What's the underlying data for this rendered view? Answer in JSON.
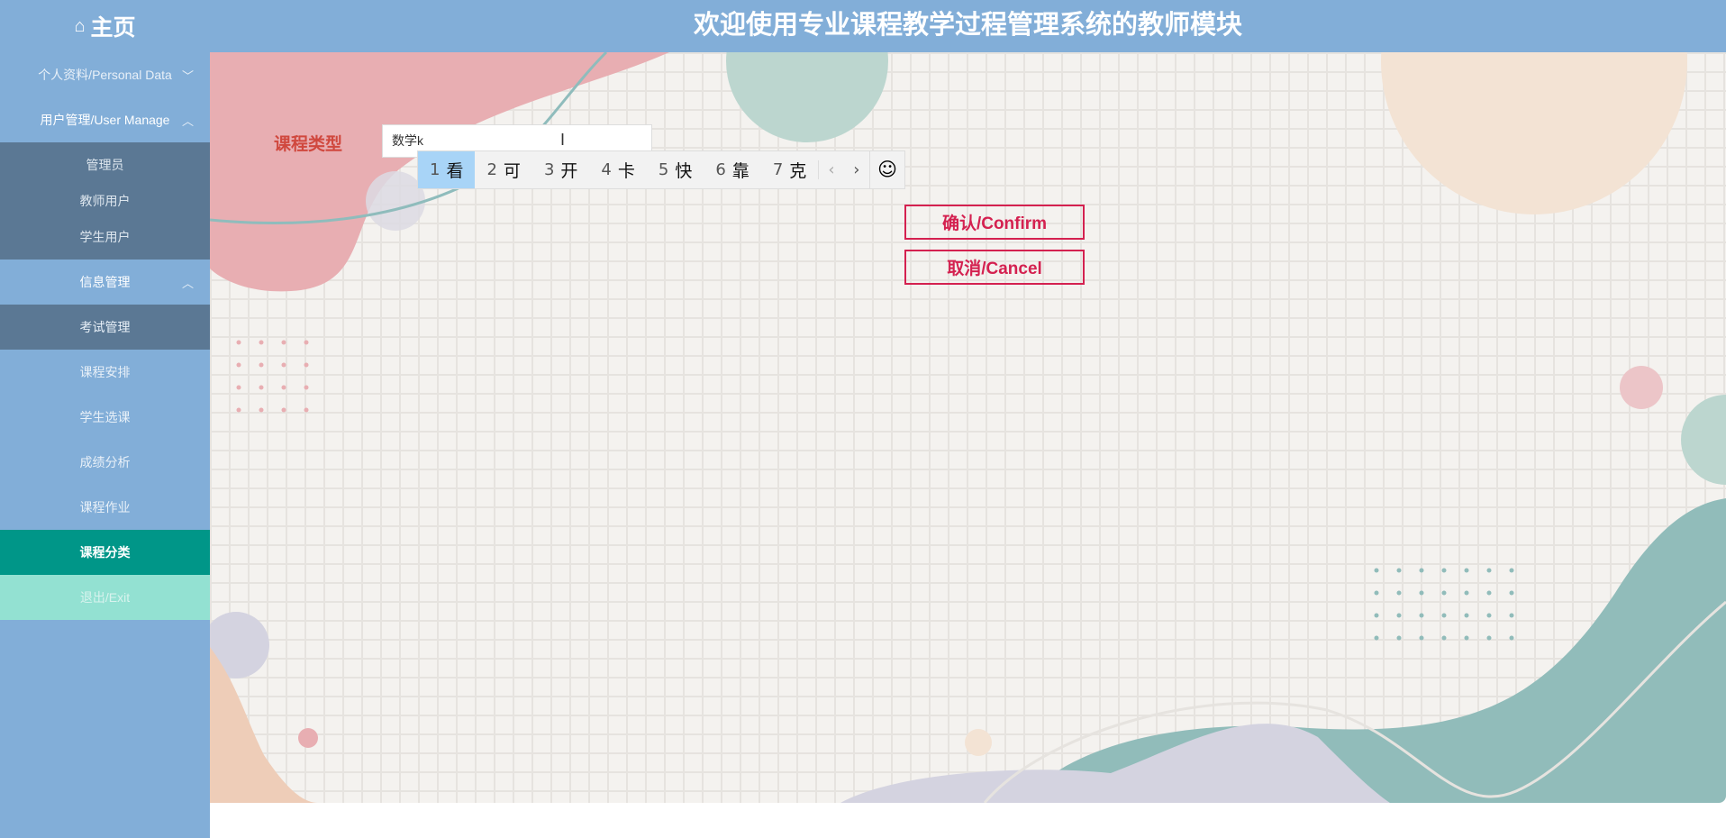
{
  "header": {
    "home_label": "主页",
    "title": "欢迎使用专业课程教学过程管理系统的教师模块"
  },
  "sidebar": {
    "personal": "个人资料/Personal Data",
    "user_manage": "用户管理/User Manage",
    "user_sub": [
      "管理员",
      "教师用户",
      "学生用户"
    ],
    "info_manage": "信息管理",
    "info_sub": [
      "考试管理",
      "课程安排",
      "学生选课",
      "成绩分析",
      "课程作业",
      "课程分类"
    ],
    "exit": "退出/Exit"
  },
  "form": {
    "label": "课程类型",
    "input_value": "数学k"
  },
  "ime": {
    "candidates": [
      {
        "n": "1",
        "c": "看"
      },
      {
        "n": "2",
        "c": "可"
      },
      {
        "n": "3",
        "c": "开"
      },
      {
        "n": "4",
        "c": "卡"
      },
      {
        "n": "5",
        "c": "快"
      },
      {
        "n": "6",
        "c": "靠"
      },
      {
        "n": "7",
        "c": "克"
      }
    ],
    "prev": "‹",
    "next": "›",
    "emoji": "☺"
  },
  "buttons": {
    "confirm": "确认/Confirm",
    "cancel": "取消/Cancel"
  },
  "colors": {
    "header": "#82aed8",
    "active": "#009688",
    "exit": "#93e1d2",
    "button": "#d42150"
  }
}
